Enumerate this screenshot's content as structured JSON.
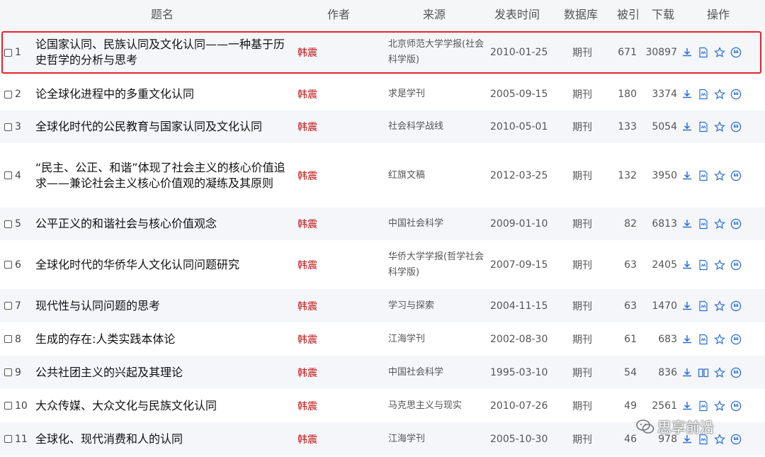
{
  "header": {
    "title": "题名",
    "author": "作者",
    "source": "来源",
    "date": "发表时间",
    "database": "数据库",
    "cited": "被引",
    "downloads": "下载",
    "actions": "操作"
  },
  "rows": [
    {
      "num": "1",
      "title": "论国家认同、民族认同及文化认同——一种基于历史哲学的分析与思考",
      "author": "韩震",
      "source": "北京师范大学学报(社会科学版)",
      "date": "2010-01-25",
      "database": "期刊",
      "cited": "671",
      "downloads": "30897",
      "read_icon": "html-read-icon"
    },
    {
      "num": "2",
      "title": "论全球化进程中的多重文化认同",
      "author": "韩震",
      "source": "求是学刊",
      "date": "2005-09-15",
      "database": "期刊",
      "cited": "180",
      "downloads": "3374",
      "read_icon": "html-read-icon"
    },
    {
      "num": "3",
      "title": "全球化时代的公民教育与国家认同及文化认同",
      "author": "韩震",
      "source": "社会科学战线",
      "date": "2010-05-01",
      "database": "期刊",
      "cited": "133",
      "downloads": "5054",
      "read_icon": "html-read-icon"
    },
    {
      "num": "4",
      "title": "“民主、公正、和谐”体现了社会主义的核心价值追求——兼论社会主义核心价值观的凝练及其原则",
      "author": "韩震",
      "source": "红旗文稿",
      "date": "2012-03-25",
      "database": "期刊",
      "cited": "132",
      "downloads": "3950",
      "read_icon": "html-read-icon"
    },
    {
      "num": "5",
      "title": "公平正义的和谐社会与核心价值观念",
      "author": "韩震",
      "source": "中国社会科学",
      "date": "2009-01-10",
      "database": "期刊",
      "cited": "82",
      "downloads": "6813",
      "read_icon": "html-read-icon"
    },
    {
      "num": "6",
      "title": "全球化时代的华侨华人文化认同问题研究",
      "author": "韩震",
      "source": "华侨大学学报(哲学社会科学版)",
      "date": "2007-09-15",
      "database": "期刊",
      "cited": "63",
      "downloads": "2405",
      "read_icon": "html-read-icon"
    },
    {
      "num": "7",
      "title": "现代性与认同问题的思考",
      "author": "韩震",
      "source": "学习与探索",
      "date": "2004-11-15",
      "database": "期刊",
      "cited": "63",
      "downloads": "1470",
      "read_icon": "html-read-icon"
    },
    {
      "num": "8",
      "title": "生成的存在:人类实践本体论",
      "author": "韩震",
      "source": "江海学刊",
      "date": "2002-08-30",
      "database": "期刊",
      "cited": "61",
      "downloads": "683",
      "read_icon": "html-read-icon"
    },
    {
      "num": "9",
      "title": "公共社团主义的兴起及其理论",
      "author": "韩震",
      "source": "中国社会科学",
      "date": "1995-03-10",
      "database": "期刊",
      "cited": "54",
      "downloads": "836",
      "read_icon": "book-read-icon"
    },
    {
      "num": "10",
      "title": "大众传媒、大众文化与民族文化认同",
      "author": "韩震",
      "source": "马克思主义与现实",
      "date": "2010-07-26",
      "database": "期刊",
      "cited": "49",
      "downloads": "2561",
      "read_icon": "html-read-icon"
    },
    {
      "num": "11",
      "title": "全球化、现代消费和人的认同",
      "author": "韩震",
      "source": "江海学刊",
      "date": "2005-10-30",
      "database": "期刊",
      "cited": "46",
      "downloads": "978",
      "read_icon": "html-read-icon"
    }
  ],
  "watermark": {
    "text": "思享前沿"
  },
  "colors": {
    "accent": "#2b6fd6",
    "author": "#c21a1a",
    "highlight": "#e5242b"
  }
}
